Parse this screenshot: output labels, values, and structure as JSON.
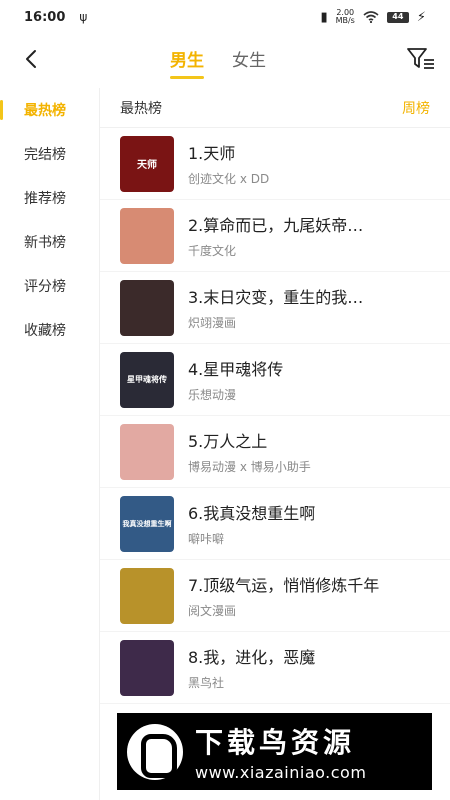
{
  "status_bar": {
    "time": "16:00",
    "usb_icon": "usb-icon",
    "speed": "2.00\nMB/s",
    "battery": "44"
  },
  "header": {
    "tabs": [
      {
        "label": "男生",
        "active": true
      },
      {
        "label": "女生",
        "active": false
      }
    ]
  },
  "sidebar": {
    "items": [
      {
        "label": "最热榜",
        "active": true
      },
      {
        "label": "完结榜",
        "active": false
      },
      {
        "label": "推荐榜",
        "active": false
      },
      {
        "label": "新书榜",
        "active": false
      },
      {
        "label": "评分榜",
        "active": false
      },
      {
        "label": "收藏榜",
        "active": false
      }
    ]
  },
  "list": {
    "title": "最热榜",
    "period": "周榜",
    "items": [
      {
        "name": "1.天师",
        "author": "创迹文化 x DD",
        "cover_text": "天师",
        "cover_color": "#7a1414"
      },
      {
        "name": "2.算命而已，九尾妖帝…",
        "author": "千度文化",
        "cover_text": "",
        "cover_color": "#d78b73"
      },
      {
        "name": "3.末日灾变，重生的我…",
        "author": "炽翊漫画",
        "cover_text": "",
        "cover_color": "#3b2a2a"
      },
      {
        "name": "4.星甲魂将传",
        "author": "乐想动漫",
        "cover_text": "星甲魂将传",
        "cover_color": "#2a2a36"
      },
      {
        "name": "5.万人之上",
        "author": "博易动漫 x 博易小助手",
        "cover_text": "",
        "cover_color": "#e2a9a2"
      },
      {
        "name": "6.我真没想重生啊",
        "author": "噼咔噼",
        "cover_text": "我真没想重生啊",
        "cover_color": "#335a86"
      },
      {
        "name": "7.顶级气运，悄悄修炼千年",
        "author": "阅文漫画",
        "cover_text": "",
        "cover_color": "#b8922a"
      },
      {
        "name": "8.我，进化，恶魔",
        "author": "黑鸟社",
        "cover_text": "",
        "cover_color": "#3e2a4a"
      }
    ]
  },
  "watermark": {
    "title": "下载鸟资源",
    "url": "www.xiazainiao.com"
  },
  "colors": {
    "accent": "#f3b300",
    "muted": "#8a8a8a"
  }
}
